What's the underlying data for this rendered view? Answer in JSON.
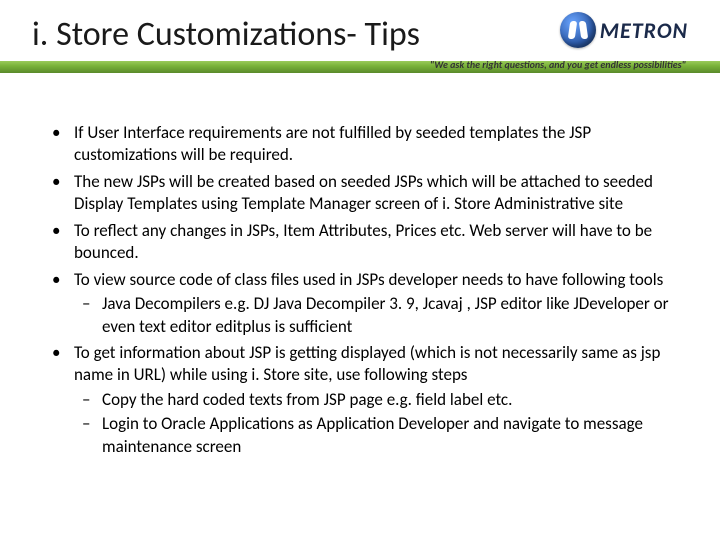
{
  "header": {
    "title": "i. Store Customizations- Tips",
    "logo_text": "METRON",
    "tagline": "\"We ask the right questions, and you get endless possibilities\""
  },
  "bullets": [
    {
      "text": " If User Interface requirements are not fulfilled by seeded templates the JSP customizations will be required.",
      "sub": []
    },
    {
      "text": "The new JSPs will be created based on seeded JSPs which will be attached to seeded Display Templates using Template Manager screen of i. Store Administrative site",
      "sub": []
    },
    {
      "text": "To reflect any changes in JSPs, Item Attributes, Prices etc. Web server will have to be bounced.",
      "sub": []
    },
    {
      "text": "To view source code of class files used in JSPs developer needs to have following tools",
      "sub": [
        "Java Decompilers e.g. DJ Java Decompiler 3. 9, Jcavaj , JSP editor like JDeveloper or even text editor editplus is sufficient"
      ]
    },
    {
      "text": "To get information about JSP is getting displayed (which is not necessarily same as jsp name in URL) while using i. Store site, use following steps",
      "sub": [
        "Copy the hard coded texts from JSP page e.g. field label etc.",
        "Login to Oracle Applications as Application Developer and navigate to message maintenance screen"
      ]
    }
  ]
}
